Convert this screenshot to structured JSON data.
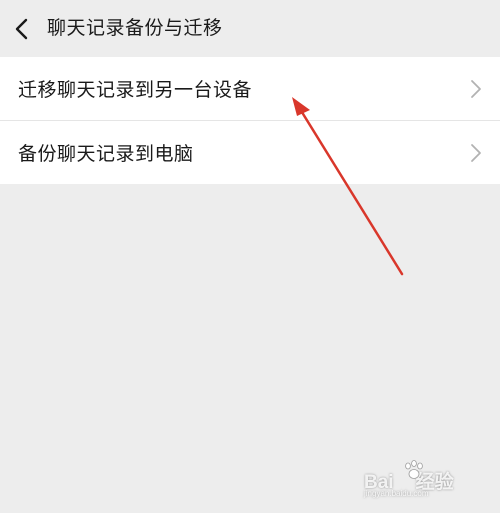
{
  "header": {
    "title": "聊天记录备份与迁移",
    "back_icon": "chevron-left-icon"
  },
  "list": {
    "items": [
      {
        "label": "迁移聊天记录到另一台设备",
        "icon": "chevron-right-icon"
      },
      {
        "label": "备份聊天记录到电脑",
        "icon": "chevron-right-icon"
      }
    ]
  },
  "annotation": {
    "arrow_color": "#d9372b"
  },
  "watermark": {
    "text_left": "Bai",
    "text_right": "经验",
    "sub": "jingyan.baidu.com"
  },
  "colors": {
    "background": "#ededed",
    "card": "#ffffff",
    "text": "#1a1a1a",
    "chevron": "#b2b2b2"
  }
}
